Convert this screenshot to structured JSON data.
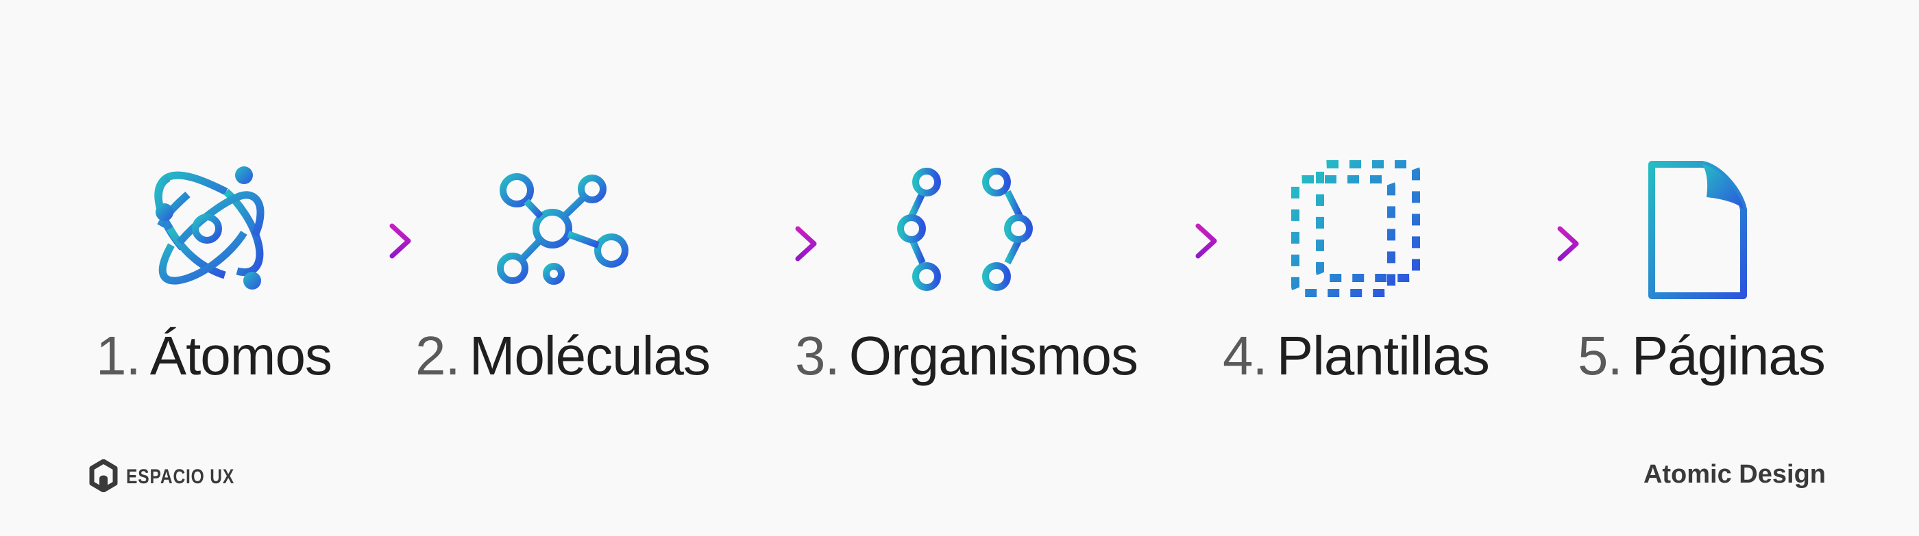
{
  "colors": {
    "background": "#f9f9fa",
    "icon_gradient_start": "#26bcc4",
    "icon_gradient_end": "#2c55dd",
    "arrow_start": "#c21fc0",
    "arrow_end": "#9a17c8",
    "number_text": "#5a5a5a",
    "name_text": "#1f1f1f",
    "footer_text": "#3a3a3a"
  },
  "stages": [
    {
      "number": "1.",
      "name": "Átomos",
      "icon": "atom-icon"
    },
    {
      "number": "2.",
      "name": "Moléculas",
      "icon": "molecule-icon"
    },
    {
      "number": "3.",
      "name": "Organismos",
      "icon": "organism-hexagon-icon"
    },
    {
      "number": "4.",
      "name": "Plantillas",
      "icon": "template-dashed-pages-icon"
    },
    {
      "number": "5.",
      "name": "Páginas",
      "icon": "page-document-icon"
    }
  ],
  "arrows": [
    "arrow-right-icon",
    "arrow-right-icon",
    "arrow-right-icon",
    "arrow-right-icon"
  ],
  "footer": {
    "brand_name": "ESPACIO UX",
    "brand_icon": "hexagon-logo-icon",
    "title": "Atomic Design"
  }
}
